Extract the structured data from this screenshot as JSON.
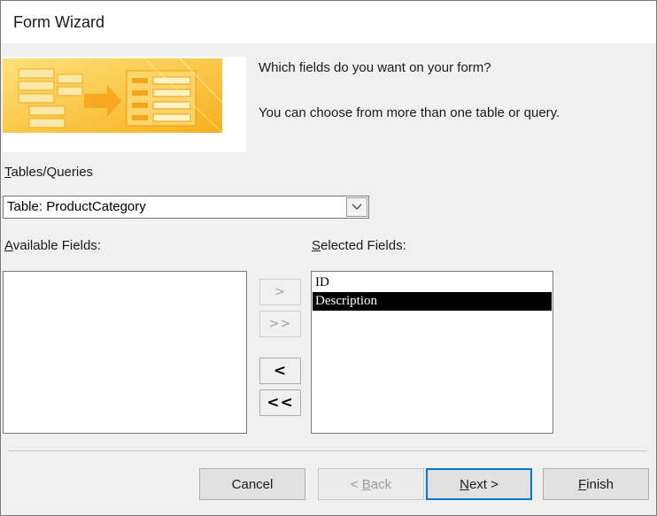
{
  "window": {
    "title": "Form Wizard"
  },
  "prompts": {
    "line1": "Which fields do you want on your form?",
    "line2": "You can choose from more than one table or query."
  },
  "tables_queries": {
    "label_mnemonic": "T",
    "label_rest": "ables/Queries",
    "selected": "Table: ProductCategory"
  },
  "available_fields": {
    "label_mnemonic": "A",
    "label_rest": "vailable Fields:",
    "items": []
  },
  "selected_fields": {
    "label_mnemonic": "S",
    "label_rest": "elected Fields:",
    "items": [
      {
        "label": "ID",
        "selected": false
      },
      {
        "label": "Description",
        "selected": true
      }
    ]
  },
  "move_buttons": {
    "add_one": ">",
    "add_all": ">>",
    "remove_one": "<",
    "remove_all": "<<"
  },
  "buttons": {
    "cancel": "Cancel",
    "back_prefix": "< ",
    "back_mnemonic": "B",
    "back_rest": "ack",
    "next_mnemonic": "N",
    "next_rest": "ext >",
    "finish_mnemonic": "F",
    "finish_rest": "inish"
  },
  "colors": {
    "selection": "#000000",
    "default_button_border": "#0078d7",
    "banner_yellow": "#f9c23c"
  },
  "icons": {
    "banner": "form-wizard-banner-icon",
    "combo": "chevron-down-icon"
  }
}
